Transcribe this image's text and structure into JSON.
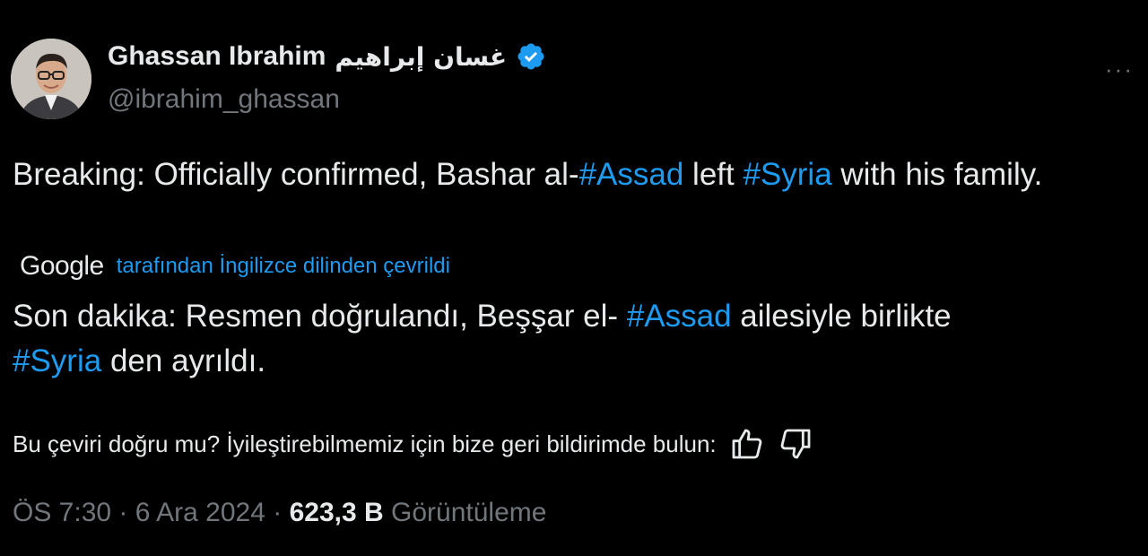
{
  "author": {
    "name": "Ghassan Ibrahim",
    "name_arabic": "غسان إبراهيم",
    "handle": "@ibrahim_ghassan",
    "verified_icon": "verified-badge-icon"
  },
  "more_menu": "···",
  "tweet": {
    "segments": [
      {
        "text": "Breaking: Officially confirmed, Bashar al-",
        "hashtag": false
      },
      {
        "text": "#Assad",
        "hashtag": true
      },
      {
        "text": " left ",
        "hashtag": false
      },
      {
        "text": "#Syria",
        "hashtag": true
      },
      {
        "text": " with his family.",
        "hashtag": false
      }
    ]
  },
  "translation": {
    "provider": "Google",
    "label": "tarafından İngilizce dilinden çevrildi",
    "segments": [
      {
        "text": "Son dakika: Resmen doğrulandı, Beşşar el- ",
        "hashtag": false
      },
      {
        "text": "#Assad",
        "hashtag": true
      },
      {
        "text": " ailesiyle birlikte ",
        "hashtag": false
      },
      {
        "text": "#Syria",
        "hashtag": true
      },
      {
        "text": " den ayrıldı.",
        "hashtag": false
      }
    ]
  },
  "feedback": {
    "question": "Bu çeviri doğru mu? İyileştirebilmemiz için bize geri bildirimde bulun:",
    "up_icon": "thumbs-up-icon",
    "down_icon": "thumbs-down-icon"
  },
  "meta": {
    "time": "ÖS 7:30",
    "separator": "·",
    "date": "6 Ara 2024",
    "views_count": "623,3 B",
    "views_label": "Görüntüleme"
  },
  "colors": {
    "background": "#000000",
    "text": "#e7e9ea",
    "muted": "#71767b",
    "accent": "#1d9bf0"
  }
}
